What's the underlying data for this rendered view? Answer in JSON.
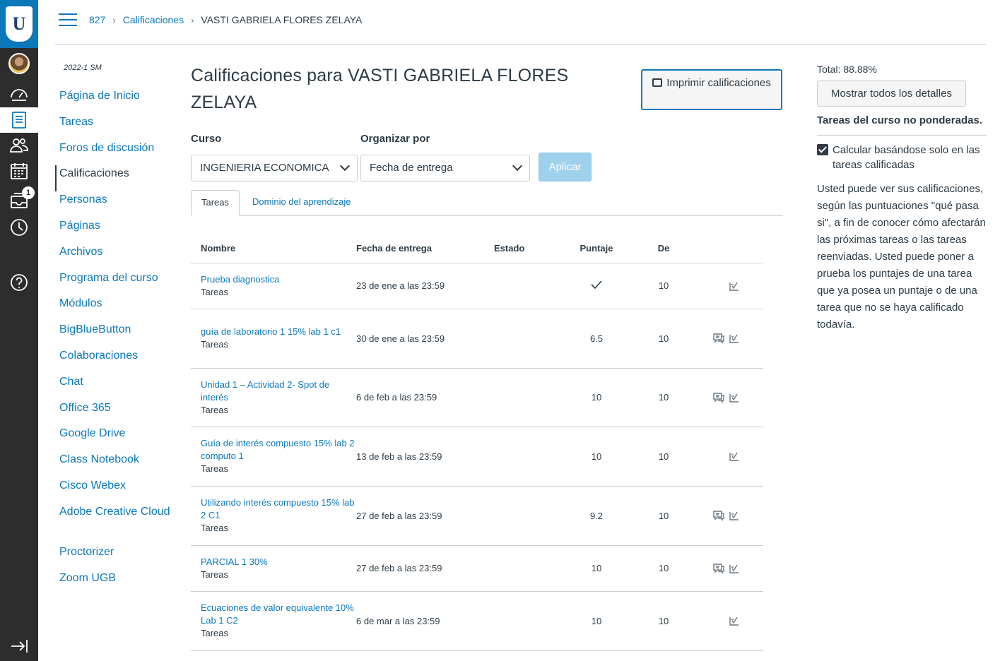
{
  "logo": {
    "letter": "U"
  },
  "global_nav": {
    "items": [
      {
        "icon": "account-avatar"
      },
      {
        "icon": "dashboard-icon"
      },
      {
        "icon": "courses-icon"
      },
      {
        "icon": "groups-icon"
      },
      {
        "icon": "calendar-icon"
      },
      {
        "icon": "inbox-icon",
        "badge": "1"
      },
      {
        "icon": "history-icon"
      },
      {
        "icon": "help-icon"
      },
      {
        "icon": "collapse-nav-icon"
      }
    ]
  },
  "breadcrumb": {
    "course": "827",
    "section": "Calificaciones",
    "current": "VASTI GABRIELA FLORES ZELAYA"
  },
  "course_nav": {
    "term": "2022-1 SM",
    "items": [
      {
        "label": "Página de Inicio"
      },
      {
        "label": "Tareas"
      },
      {
        "label": "Foros de discusión"
      },
      {
        "label": "Calificaciones",
        "active": true
      },
      {
        "label": "Personas"
      },
      {
        "label": "Páginas"
      },
      {
        "label": "Archivos"
      },
      {
        "label": "Programa del curso"
      },
      {
        "label": "Módulos"
      },
      {
        "label": "BigBlueButton"
      },
      {
        "label": "Colaboraciones"
      },
      {
        "label": "Chat"
      },
      {
        "label": "Office 365"
      },
      {
        "label": "Google Drive"
      },
      {
        "label": "Class Notebook"
      },
      {
        "label": "Cisco Webex"
      },
      {
        "label": "Adobe Creative Cloud"
      },
      {
        "label": "Proctorizer"
      },
      {
        "label": "Zoom UGB"
      }
    ]
  },
  "main": {
    "title": "Calificaciones para VASTI GABRIELA FLORES ZELAYA",
    "print_button": "Imprimir calificaciones",
    "course_label": "Curso",
    "course_value": "INGENIERIA ECONOMICA",
    "sort_label": "Organizar por",
    "sort_value": "Fecha de entrega",
    "apply_button": "Aplicar",
    "tabs": [
      "Tareas",
      "Dominio del aprendizaje"
    ],
    "columns": {
      "name": "Nombre",
      "date": "Fecha de entrega",
      "status": "Estado",
      "score": "Puntaje",
      "of": "De"
    },
    "rows": [
      {
        "name": "Prueba diagnostica",
        "category": "Tareas",
        "date": "23 de ene a las 23:59",
        "status": "",
        "score": "",
        "score_icon": "checkmark-icon",
        "of": "10",
        "comments": false
      },
      {
        "name": "guía de laboratorio 1 15% lab 1 c1",
        "category": "Tareas",
        "date": "30 de ene a las 23:59",
        "status": "",
        "score": "6.5",
        "of": "10",
        "comments": true
      },
      {
        "name": "Unidad 1 – Actividad 2- Spot de interés",
        "category": "Tareas",
        "date": "6 de feb a las 23:59",
        "status": "",
        "score": "10",
        "of": "10",
        "comments": true
      },
      {
        "name": "Guía de interés compuesto 15% lab 2 computo 1",
        "category": "Tareas",
        "date": "13 de feb a las 23:59",
        "status": "",
        "score": "10",
        "of": "10",
        "comments": false
      },
      {
        "name": "Utilizando interés compuesto 15% lab 2 C1",
        "category": "Tareas",
        "date": "27 de feb a las 23:59",
        "status": "",
        "score": "9.2",
        "of": "10",
        "comments": true
      },
      {
        "name": "PARCIAL 1 30%",
        "category": "Tareas",
        "date": "27 de feb a las 23:59",
        "status": "",
        "score": "10",
        "of": "10",
        "comments": true
      },
      {
        "name": " Ecuaciones de valor equivalente 10% Lab 1 C2",
        "category": "Tareas",
        "date": "6 de mar a las 23:59",
        "status": "",
        "score": "10",
        "of": "10",
        "comments": false
      }
    ]
  },
  "aside": {
    "total": "Total: 88.88%",
    "details_button": "Mostrar todos los detalles",
    "unweighted": "Tareas del curso no ponderadas.",
    "calc_label": "Calcular basándose solo en las tareas calificadas",
    "calc_checked": true,
    "whatif_text": "Usted puede ver sus calificaciones, según las puntuaciones \"qué pasa si\", a fin de conocer cómo afectarán las próximas tareas o las tareas reenviadas. Usted puede poner a prueba los puntajes de una tarea que ya posea un puntaje o de una tarea que no se haya calificado todavía."
  }
}
